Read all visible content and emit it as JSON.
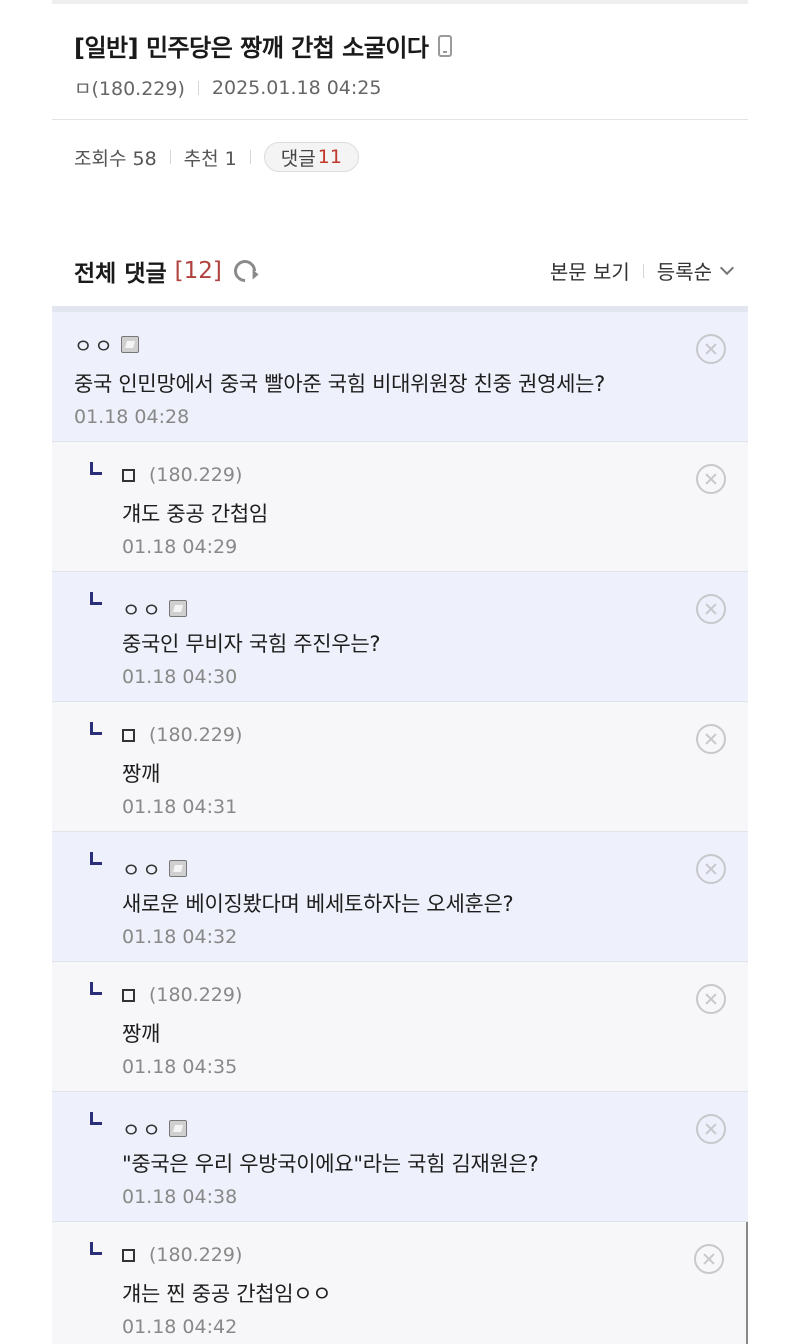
{
  "post": {
    "title": "[일반] 민주당은 짱깨 간첩 소굴이다",
    "author": "ㅁ(180.229)",
    "date": "2025.01.18 04:25"
  },
  "stats": {
    "views_label": "조회수 58",
    "recommend_label": "추천 1",
    "replies_label": "댓글",
    "replies_count": "11"
  },
  "comments_header": {
    "title": "전체 댓글",
    "count": "[12]",
    "view_post": "본문 보기",
    "sort": "등록순"
  },
  "comments": [
    {
      "author": "ㅇㅇ",
      "ip": "",
      "text": "중국 인민망에서 중국 빨아준 국힘 비대위원장 친중 권영세는?",
      "date": "01.18 04:28"
    },
    {
      "author": "ㅁ",
      "ip": "(180.229)",
      "text": "걔도 중공 간첩임",
      "date": "01.18 04:29"
    },
    {
      "author": "ㅇㅇ",
      "ip": "",
      "text": "중국인 무비자 국힘 주진우는?",
      "date": "01.18 04:30"
    },
    {
      "author": "ㅁ",
      "ip": "(180.229)",
      "text": "짱깨",
      "date": "01.18 04:31"
    },
    {
      "author": "ㅇㅇ",
      "ip": "",
      "text": "새로운 베이징봤다며 베세토하자는 오세훈은?",
      "date": "01.18 04:32"
    },
    {
      "author": "ㅁ",
      "ip": "(180.229)",
      "text": "짱깨",
      "date": "01.18 04:35"
    },
    {
      "author": "ㅇㅇ",
      "ip": "",
      "text": "\"중국은 우리 우방국이에요\"라는 국힘 김재원은?",
      "date": "01.18 04:38"
    },
    {
      "author": "ㅁ",
      "ip": "(180.229)",
      "text": "걔는 찐 중공 간첩임ㅇㅇ",
      "date": "01.18 04:42"
    }
  ]
}
